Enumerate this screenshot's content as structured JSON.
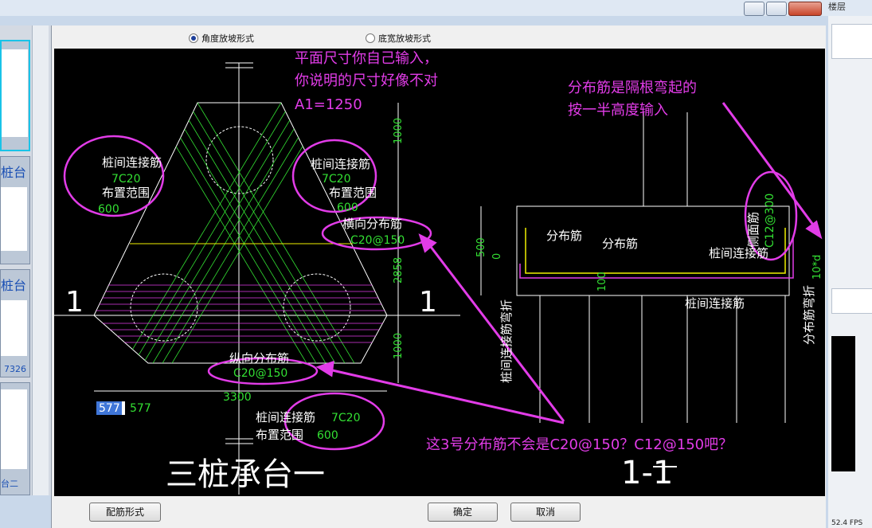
{
  "window": {
    "right_title_fragment": "楼层",
    "fps_text": "52.4 FPS"
  },
  "left_panel": {
    "thumb_labels": [
      "桩台",
      "桩台"
    ],
    "thumb_number": "7326",
    "thumb_bottom_label": "台二"
  },
  "dialog": {
    "options": [
      {
        "label": "角度放坡形式",
        "selected": true
      },
      {
        "label": "底宽放坡形式",
        "selected": false
      }
    ],
    "buttons": {
      "rebar_form": "配筋形式",
      "ok": "确定",
      "cancel": "取消"
    }
  },
  "drawing": {
    "plan_title": "三桩承台一",
    "section_title": "1-1",
    "section_marker": "1",
    "dim_top": "1000",
    "dim_mid": "2858",
    "dim_bottom": "1000",
    "dim_width": "3300",
    "dim_577": "577",
    "edit_value": "577",
    "dim_500": "500",
    "dim_0": "0",
    "dim_100": "100",
    "labels": {
      "pile_conn": "桩间连接筋",
      "pile_conn_val": "7C20",
      "range": "布置范围",
      "range_val": "600",
      "horiz_dist": "横向分布筋",
      "horiz_val": "C20@150",
      "long_dist": "纵向分布筋",
      "long_val": "C20@150",
      "dist": "分布筋",
      "side_face": "侧面筋",
      "side_val": "C12@300",
      "pile_conn_bend": "桩间连接筋弯折",
      "dist_bend": "分布筋弯折",
      "ten_d": "10*d"
    },
    "annotations": {
      "note1": [
        "平面尺寸你自己输入，",
        "你说明的尺寸好像不对",
        "A1=1250"
      ],
      "note2": [
        "分布筋是隔根弯起的",
        "按一半高度输入"
      ],
      "note3": "这3号分布筋不会是C20@150？C12@150吧？"
    },
    "colors": {
      "annotation": "#e23ce8",
      "rebar": "#33e033",
      "line": "#ffffff",
      "yellow": "#f0f000"
    }
  }
}
